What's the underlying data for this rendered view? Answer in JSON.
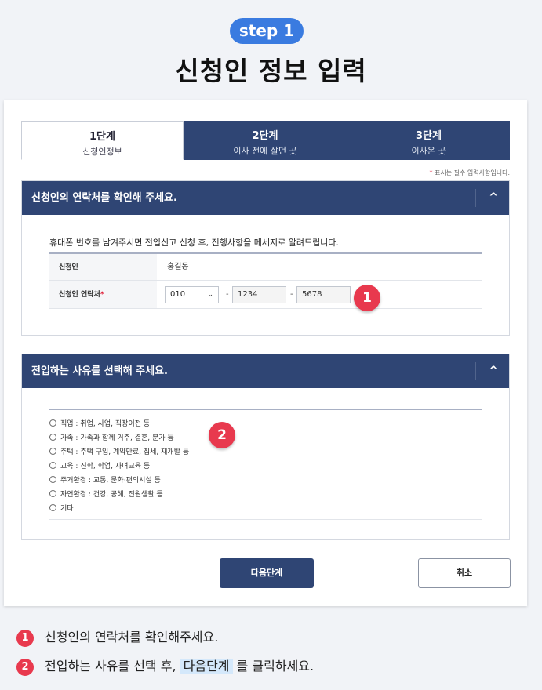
{
  "header": {
    "step_label": "step 1",
    "title": "신청인 정보 입력"
  },
  "tabs": [
    {
      "title": "1단계",
      "subtitle": "신청인정보"
    },
    {
      "title": "2단계",
      "subtitle": "이사 전에 살던 곳"
    },
    {
      "title": "3단계",
      "subtitle": "이사온 곳"
    }
  ],
  "required_note": {
    "star": "*",
    "text": " 표시는 필수 입력사항입니다."
  },
  "section1": {
    "heading": "신청인의 연락처를 확인해 주세요.",
    "collapse_icon": "chevron-up-icon",
    "chevron": "^",
    "description": "휴대폰 번호를 남겨주시면 전입신고 신청 후, 진행사항을 메세지로 알려드립니다.",
    "name_label": "신청인",
    "name_value": "홍길동",
    "phone_label": "신청인 연락처",
    "phone_star": "*",
    "phone_prefix": "010",
    "phone_caret": "⌄",
    "phone_middle": "1234",
    "phone_last": "5678",
    "dash": "-",
    "badge": "1"
  },
  "section2": {
    "heading": "전입하는 사유를 선택해 주세요.",
    "chevron": "^",
    "badge": "2",
    "options": [
      "직업 : 취업, 사업, 직장이전 등",
      "가족 : 가족과 함께 거주, 결혼, 분가 등",
      "주택 : 주택 구입, 계약만료, 집세, 재개발 등",
      "교육 : 진학, 학업, 자녀교육 등",
      "주거환경 : 교통, 문화·편의시설 등",
      "자연환경 : 건강, 공해, 전원생활 등",
      "기타"
    ]
  },
  "buttons": {
    "next": "다음단계",
    "cancel": "취소"
  },
  "instructions": {
    "item1_num": "1",
    "item1_text": "신청인의 연락처를 확인해주세요.",
    "item2_num": "2",
    "item2_before": "전입하는 사유를 선택 후, ",
    "item2_highlight": "다음단계",
    "item2_after": " 를 클릭하세요."
  },
  "colors": {
    "navy": "#2f4574",
    "accent_blue": "#3a7be0",
    "badge_red": "#e8394e"
  }
}
